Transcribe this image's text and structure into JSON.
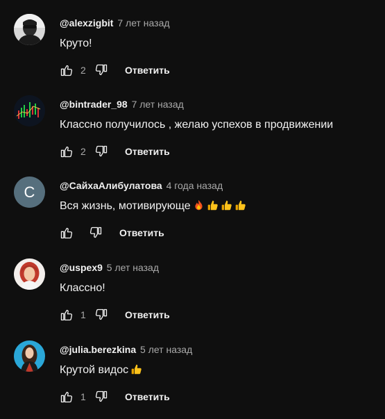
{
  "comments": [
    {
      "author": "@alexzigbit",
      "time": "7 лет назад",
      "text": "Круто!",
      "likes": "2",
      "reply_label": "Ответить",
      "avatar_kind": "photo-dark-man"
    },
    {
      "author": "@bintrader_98",
      "time": "7 лет назад",
      "text": "Классно получилось , желаю успехов в продвижении",
      "likes": "2",
      "reply_label": "Ответить",
      "avatar_kind": "trading-chart"
    },
    {
      "author": "@СайхаАлибулатова",
      "time": "4 года назад",
      "text": "Вся жизнь, мотивирующе",
      "emojis": [
        "fire-emoji",
        "thumbs-up-emoji",
        "thumbs-up-emoji",
        "thumbs-up-emoji"
      ],
      "likes": "",
      "reply_label": "Ответить",
      "avatar_letter": "С",
      "avatar_color": "#566f7d"
    },
    {
      "author": "@uspex9",
      "time": "5 лет назад",
      "text": "Классно!",
      "likes": "1",
      "reply_label": "Ответить",
      "avatar_kind": "photo-red-hair-woman"
    },
    {
      "author": "@julia.berezkina",
      "time": "5 лет назад",
      "text": "Крутой видос",
      "emojis": [
        "thumbs-up-emoji"
      ],
      "likes": "1",
      "reply_label": "Ответить",
      "avatar_kind": "photo-woman-blue-bg"
    }
  ],
  "colors": {
    "background": "#0f0f0f",
    "primary_text": "#f1f1f1",
    "secondary_text": "#aaaaaa"
  }
}
